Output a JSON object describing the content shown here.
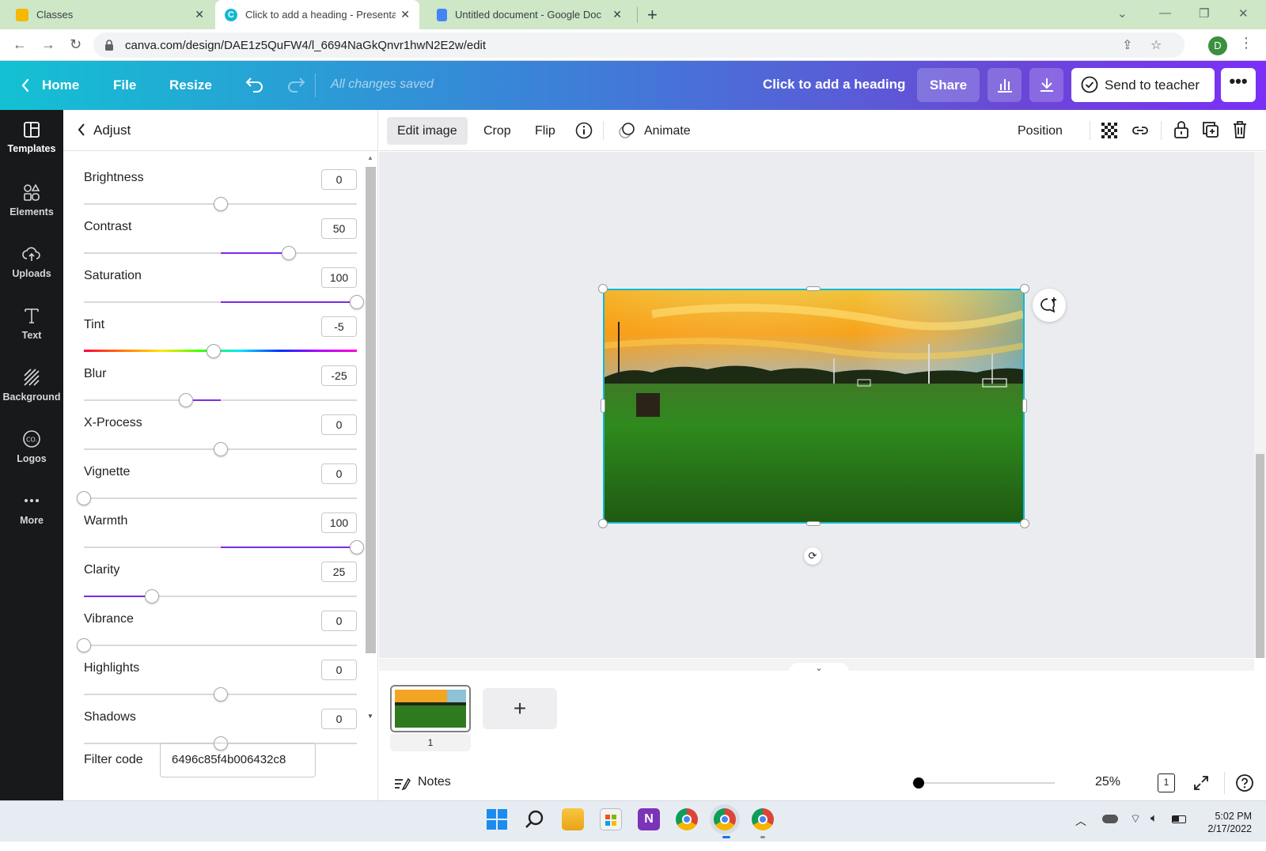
{
  "browser": {
    "tabs": [
      {
        "title": "Classes",
        "active": false
      },
      {
        "title": "Click to add a heading - Presenta",
        "active": true
      },
      {
        "title": "Untitled document - Google Doc",
        "active": false
      }
    ],
    "url": "canva.com/design/DAE1z5QuFW4/l_6694NaGkQnvr1hwN2E2w/edit",
    "profile_initial": "D"
  },
  "header": {
    "home": "Home",
    "file": "File",
    "resize": "Resize",
    "saved_status": "All changes saved",
    "design_title": "Click to add a heading",
    "share": "Share",
    "send_to_teacher": "Send to teacher"
  },
  "rail": [
    {
      "label": "Templates",
      "icon": "templates-icon"
    },
    {
      "label": "Elements",
      "icon": "elements-icon"
    },
    {
      "label": "Uploads",
      "icon": "uploads-icon"
    },
    {
      "label": "Text",
      "icon": "text-icon"
    },
    {
      "label": "Background",
      "icon": "background-icon"
    },
    {
      "label": "Logos",
      "icon": "logos-icon"
    },
    {
      "label": "More",
      "icon": "more-icon"
    }
  ],
  "panel": {
    "title": "Adjust",
    "adjustments": [
      {
        "label": "Brightness",
        "value": "0",
        "num": 0,
        "min": -100,
        "max": 100
      },
      {
        "label": "Contrast",
        "value": "50",
        "num": 50,
        "min": -100,
        "max": 100
      },
      {
        "label": "Saturation",
        "value": "100",
        "num": 100,
        "min": -100,
        "max": 100
      },
      {
        "label": "Tint",
        "value": "-5",
        "num": -5,
        "min": -100,
        "max": 100,
        "rainbow": true
      },
      {
        "label": "Blur",
        "value": "-25",
        "num": -25,
        "min": -100,
        "max": 100
      },
      {
        "label": "X-Process",
        "value": "0",
        "num": 0,
        "min": -100,
        "max": 100
      },
      {
        "label": "Vignette",
        "value": "0",
        "num": 0,
        "min": 0,
        "max": 100
      },
      {
        "label": "Warmth",
        "value": "100",
        "num": 100,
        "min": -100,
        "max": 100
      },
      {
        "label": "Clarity",
        "value": "25",
        "num": 25,
        "min": 0,
        "max": 100
      },
      {
        "label": "Vibrance",
        "value": "0",
        "num": 0,
        "min": 0,
        "max": 100
      },
      {
        "label": "Highlights",
        "value": "0",
        "num": 0,
        "min": -100,
        "max": 100
      },
      {
        "label": "Shadows",
        "value": "0",
        "num": 0,
        "min": -100,
        "max": 100
      }
    ],
    "filter_code_label": "Filter code",
    "filter_code_value": "6496c85f4b006432c8"
  },
  "toolbar": {
    "edit_image": "Edit image",
    "crop": "Crop",
    "flip": "Flip",
    "animate": "Animate",
    "position": "Position"
  },
  "pages": {
    "page_number": "1"
  },
  "footer": {
    "notes": "Notes",
    "zoom": "25%",
    "zoom_fraction": 0.05,
    "page_count": "1"
  },
  "taskbar": {
    "time": "5:02 PM",
    "date": "2/17/2022"
  },
  "colors": {
    "accent": "#7d2ae8",
    "selection": "#13b8d3",
    "header_start": "#13c1d3",
    "header_end": "#7b2ff7"
  }
}
